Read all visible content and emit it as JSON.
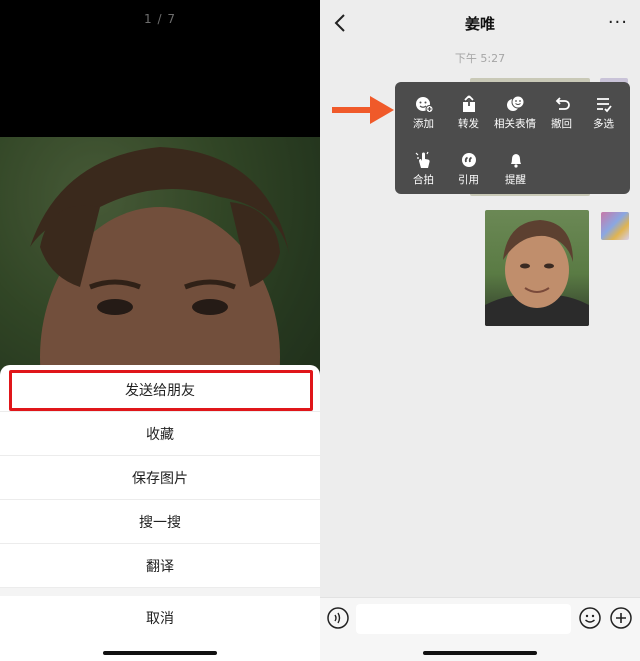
{
  "left": {
    "counter": "1 / 7",
    "sheet_items": [
      "发送给朋友",
      "收藏",
      "保存图片",
      "搜一搜",
      "翻译"
    ],
    "cancel": "取消"
  },
  "right": {
    "title": "姜唯",
    "more": "···",
    "time": "下午 5:27",
    "menu": {
      "row1": [
        "添加",
        "转发",
        "相关表情",
        "撤回",
        "多选"
      ],
      "row2": [
        "合拍",
        "引用",
        "提醒"
      ]
    }
  },
  "colors": {
    "highlight": "#e0161a",
    "arrow": "#f05a2a",
    "menu_bg": "#4c4c4c"
  },
  "icons": [
    "back-icon",
    "more-icon",
    "add-sticker-icon",
    "forward-icon",
    "related-stickers-icon",
    "recall-icon",
    "multi-select-icon",
    "pat-icon",
    "quote-icon",
    "remind-icon",
    "voice-icon",
    "emoji-icon",
    "plus-icon"
  ]
}
